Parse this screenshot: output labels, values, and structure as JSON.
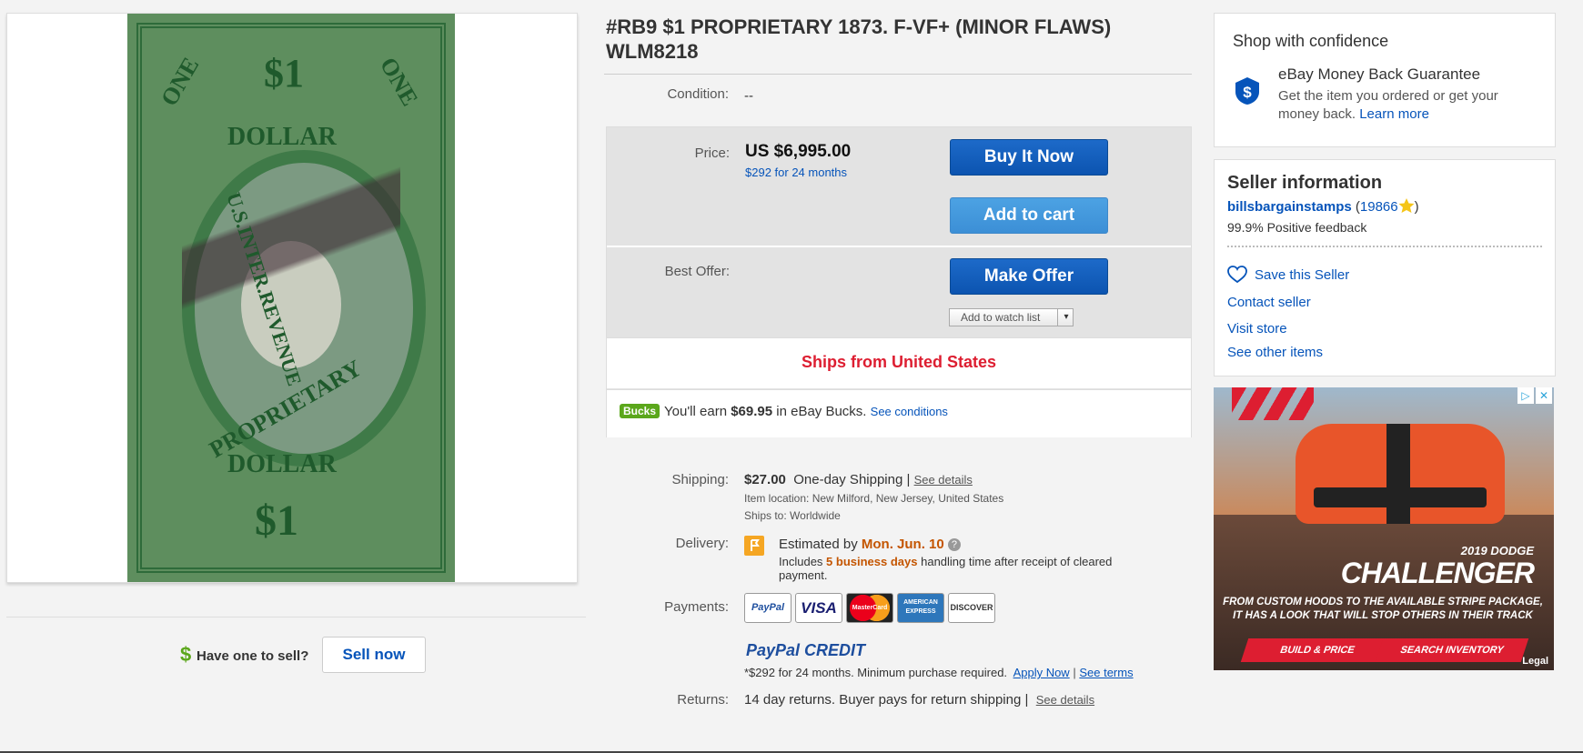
{
  "listing": {
    "title": "#RB9 $1 PROPRIETARY 1873. F-VF+ (MINOR FLAWS) WLM8218",
    "condition_label": "Condition:",
    "condition_value": "--"
  },
  "stamp_image": {
    "top_left": "ONE",
    "top_center": "$1",
    "top_right": "ONE",
    "upper": "DOLLAR",
    "side": "U.S.INTER.REVENUE",
    "lower": "PROPRIETARY",
    "bottom": "DOLLAR",
    "bottom_denom": "$1"
  },
  "sell": {
    "dollar": "$",
    "question": "Have one to sell?",
    "button": "Sell now"
  },
  "price": {
    "label": "Price:",
    "value": "US $6,995.00",
    "financing": "$292 for 24 months",
    "buy_now": "Buy It Now",
    "add_to_cart": "Add to cart"
  },
  "offer": {
    "label": "Best Offer:",
    "button": "Make Offer",
    "watch": "Add to watch list",
    "watch_caret": "▾"
  },
  "ships_from": "Ships from United States",
  "bucks": {
    "badge": "Bucks",
    "prefix": "You'll earn ",
    "amount": "$69.95",
    "suffix": " in eBay Bucks.",
    "link": "See conditions"
  },
  "shipping": {
    "label": "Shipping:",
    "cost": "$27.00",
    "service": "One-day Shipping |",
    "details": "See details",
    "location_label": "Item location:",
    "location": "New Milford, New Jersey, United States",
    "ships_to_label": "Ships to:",
    "ships_to": "Worldwide"
  },
  "delivery": {
    "label": "Delivery:",
    "estimated": "Estimated by ",
    "date": "Mon. Jun. 10",
    "help": "?",
    "includes": "Includes ",
    "days": "5 business days",
    "rest": " handling time after receipt of cleared payment."
  },
  "payments": {
    "label": "Payments:",
    "logos": [
      "PayPal",
      "VISA",
      "MasterCard",
      "AMERICAN EXPRESS",
      "DISCOVER"
    ],
    "credit_logo": "PayPal CREDIT",
    "credit_text": "*$292 for 24 months. Minimum purchase required.",
    "apply": "Apply Now",
    "sep": "|",
    "terms": "See terms"
  },
  "returns": {
    "label": "Returns:",
    "text": "14 day returns. Buyer pays for return shipping |",
    "details": "See details"
  },
  "confidence": {
    "heading": "Shop with confidence",
    "guarantee_title": "eBay Money Back Guarantee",
    "guarantee_text": "Get the item you ordered or get your money back.",
    "learn_more": "Learn more"
  },
  "seller": {
    "heading": "Seller information",
    "name": "billsbargainstamps",
    "score_open": "(",
    "score": "19866",
    "score_close": ")",
    "feedback": "99.9% Positive feedback",
    "save": "Save this Seller",
    "contact": "Contact seller",
    "visit": "Visit store",
    "other": "See other items"
  },
  "ad": {
    "year_model": "2019 DODGE",
    "model": "CHALLENGER",
    "tagline_1": "FROM CUSTOM HOODS TO THE AVAILABLE STRIPE PACKAGE,",
    "tagline_2": "IT HAS A LOOK THAT WILL STOP OTHERS IN THEIR TRACK",
    "btn_build": "BUILD & PRICE",
    "btn_search": "SEARCH INVENTORY",
    "legal": "Legal",
    "adchoices": "▷",
    "close": "✕"
  },
  "colors": {
    "accent_blue": "#0654ba",
    "ships_red": "#dd1e31",
    "delivery_orange": "#c45500",
    "bucks_green": "#5ba71b"
  }
}
